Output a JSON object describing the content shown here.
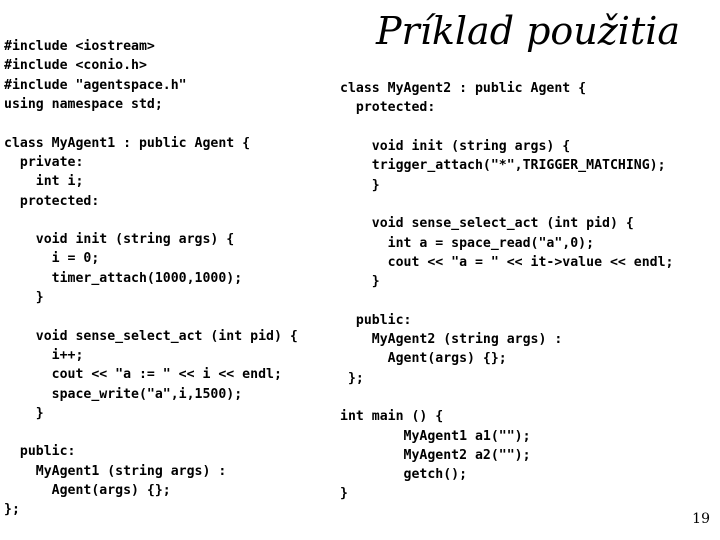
{
  "slide": {
    "title": "Príklad použitia",
    "page_number": "19",
    "text_color": "#000000",
    "background_color": "#ffffff"
  },
  "code_left": {
    "language": "cpp",
    "lines": [
      "#include <iostream>",
      "#include <conio.h>",
      "#include \"agentspace.h\"",
      "using namespace std;",
      "",
      "class MyAgent1 : public Agent {",
      "  private:",
      "    int i;",
      "  protected:",
      "",
      "    void init (string args) {",
      "      i = 0;",
      "      timer_attach(1000,1000);",
      "    }",
      "",
      "    void sense_select_act (int pid) {",
      "      i++;",
      "      cout << \"a := \" << i << endl;",
      "      space_write(\"a\",i,1500);",
      "    }",
      "",
      "  public:",
      "    MyAgent1 (string args) :",
      "      Agent(args) {};",
      "};"
    ]
  },
  "code_right": {
    "language": "cpp",
    "lines": [
      "class MyAgent2 : public Agent {",
      "  protected:",
      "",
      "    void init (string args) {",
      "    trigger_attach(\"*\",TRIGGER_MATCHING);",
      "    }",
      "",
      "    void sense_select_act (int pid) {",
      "      int a = space_read(\"a\",0);",
      "      cout << \"a = \" << it->value << endl;",
      "    }",
      "",
      "  public:",
      "    MyAgent2 (string args) :",
      "      Agent(args) {};",
      " };",
      "",
      "int main () {",
      "        MyAgent1 a1(\"\");",
      "        MyAgent2 a2(\"\");",
      "        getch();",
      "}"
    ]
  }
}
